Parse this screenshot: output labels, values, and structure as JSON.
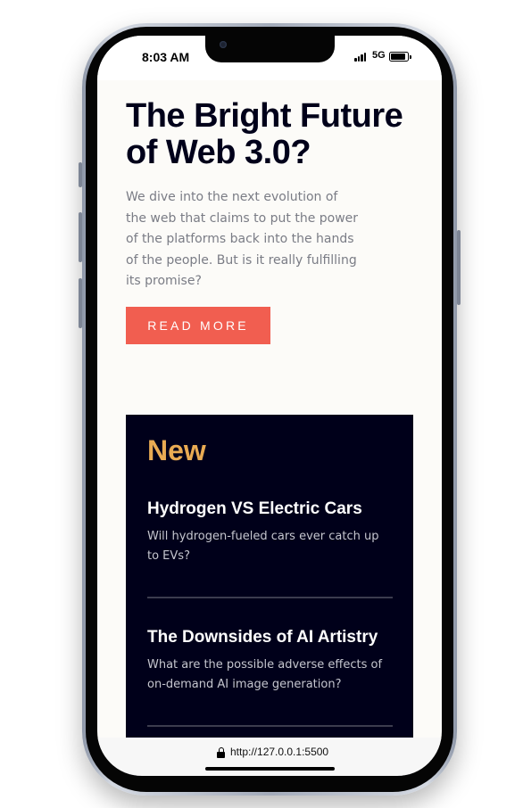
{
  "status_bar": {
    "time": "8:03 AM",
    "network": "5G",
    "icons": [
      "signal-icon",
      "battery-icon"
    ]
  },
  "hero": {
    "title": "The Bright Future of Web 3.0?",
    "description": "We dive into the next evolution of the web that claims to put the power of the platforms back into the hands of the people. But is it really fulfilling its promise?",
    "button_label": "READ MORE"
  },
  "new_section": {
    "heading": "New",
    "items": [
      {
        "title": "Hydrogen VS Electric Cars",
        "description": "Will hydrogen-fueled cars ever catch up to EVs?"
      },
      {
        "title": "The Downsides of AI Artistry",
        "description": "What are the possible adverse effects of on-demand AI image generation?"
      }
    ]
  },
  "browser": {
    "url": "http://127.0.0.1:5500",
    "icons": [
      "lock-icon"
    ]
  },
  "colors": {
    "accent": "#f15e50",
    "dark_navy": "#00001a",
    "new_heading": "#e9ab53",
    "page_bg": "#fcfbf8"
  }
}
